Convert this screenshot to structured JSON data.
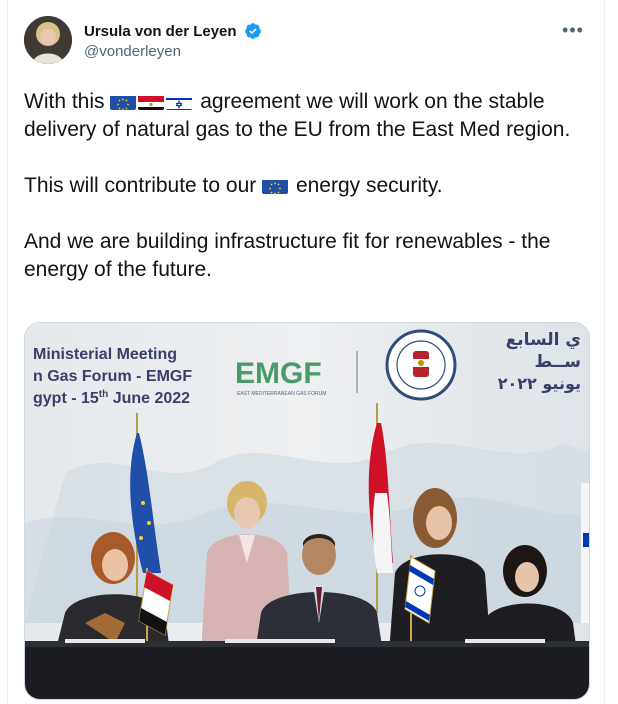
{
  "author": {
    "display_name": "Ursula von der Leyen",
    "handle": "@vonderleyen",
    "avatar_icon": "avatar-photo",
    "verified_icon": "verified-badge-icon",
    "verified_color": "#1d9bf0"
  },
  "more_icon": "more-options-icon",
  "tweet": {
    "para1_a": "With this",
    "para1_b": "agreement we will work on the stable delivery of natural gas to the EU from the East Med region.",
    "para2_a": "This will contribute to our",
    "para2_b": "energy security.",
    "para3": "And we are building infrastructure fit for renewables - the energy of the future.",
    "flags": [
      "eu-flag-icon",
      "egypt-flag-icon",
      "israel-flag-icon"
    ]
  },
  "media": {
    "banner_line1": "Ministerial Meeting",
    "banner_line2": "n Gas Forum - EMGF",
    "banner_line3_a": "gypt - 15",
    "banner_line3_sup": "th",
    "banner_line3_b": " June 2022",
    "logo_text": "EMGF",
    "logo_subtext": "EAST MEDITERRANEAN GAS FORUM",
    "arabic_line1": "ي السابع",
    "arabic_line2": "ســط",
    "arabic_line3": "يونيو ٢٠٢٢"
  }
}
